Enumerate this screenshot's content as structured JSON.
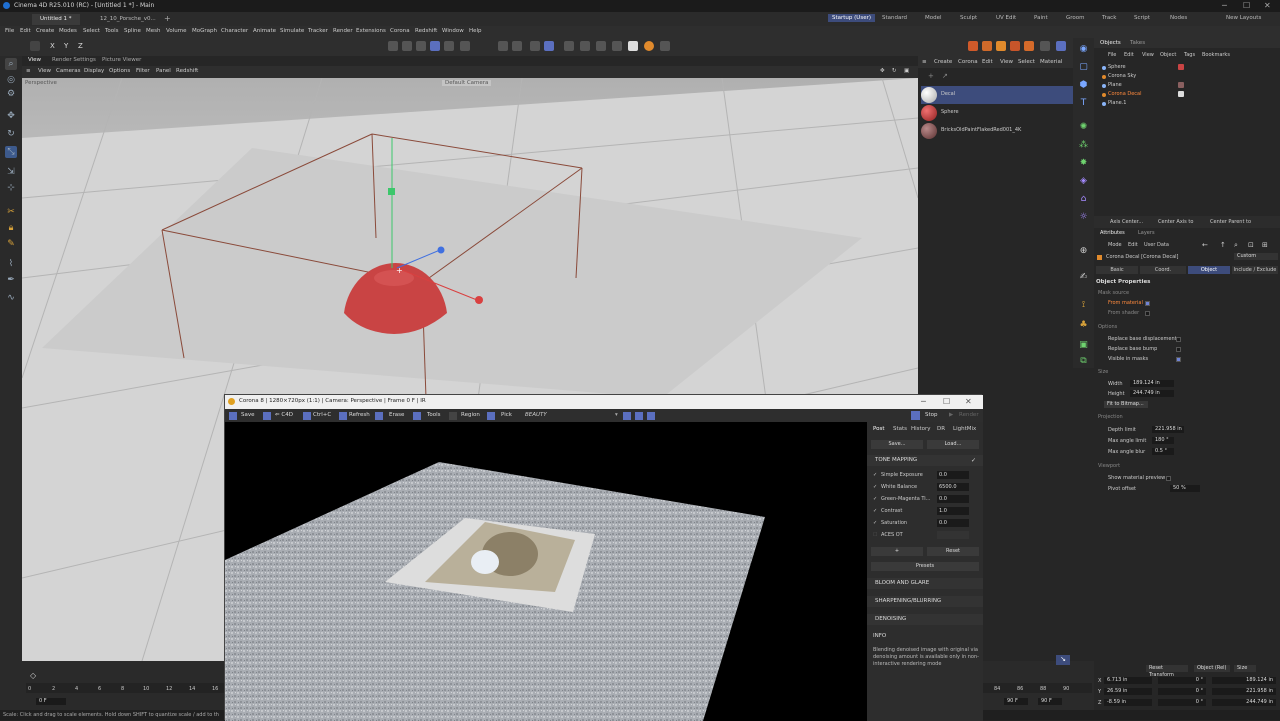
{
  "window_title": "Cinema 4D R25.010 (RC) - [Untitled 1 *] - Main",
  "doc_tabs": [
    "Untitled 1 *",
    "12_10_Porsche_v0..."
  ],
  "layouts": [
    "Startup (User)",
    "Standard",
    "Model",
    "Sculpt",
    "UV Edit",
    "Paint",
    "Groom",
    "Track",
    "Script",
    "Nodes"
  ],
  "new_layouts": "New Layouts",
  "menu": [
    "File",
    "Edit",
    "Create",
    "Modes",
    "Select",
    "Tools",
    "Spline",
    "Mesh",
    "Volume",
    "MoGraph",
    "Character",
    "Animate",
    "Simulate",
    "Tracker",
    "Render",
    "Extensions",
    "Corona",
    "Redshift",
    "Window",
    "Help"
  ],
  "toolbar_axes": [
    "X",
    "Y",
    "Z"
  ],
  "viewport": {
    "tabs": [
      "View",
      "Render Settings",
      "Picture Viewer"
    ],
    "menu": [
      "View",
      "Cameras",
      "Display",
      "Options",
      "Filter",
      "Panel",
      "Redshift"
    ],
    "projection": "Perspective",
    "camera": "Default Camera"
  },
  "materials": {
    "menu": [
      "Create",
      "Corona",
      "Edit",
      "View",
      "Select",
      "Material"
    ],
    "items": [
      {
        "name": "Decal",
        "color": "#e8e8e8"
      },
      {
        "name": "Sphere",
        "color": "#c03a3a"
      },
      {
        "name": "BricksOldPaintFlakedRed001_4K",
        "color": "#8a5a5a"
      }
    ]
  },
  "objects": {
    "tabs": [
      "Objects",
      "Takes"
    ],
    "menu": [
      "File",
      "Edit",
      "View",
      "Object",
      "Tags",
      "Bookmarks"
    ],
    "items": [
      "Sphere",
      "Corona Sky",
      "Plane",
      "Corona Decal",
      "Plane.1"
    ]
  },
  "axis_bar": [
    "Axis Center...",
    "Center Axis to",
    "Center Parent to"
  ],
  "attributes": {
    "tabs": [
      "Attributes",
      "Layers"
    ],
    "menu": [
      "Mode",
      "Edit",
      "User Data"
    ],
    "object_name": "Corona Decal [Corona Decal]",
    "preset": "Custom",
    "subtabs": [
      "Basic",
      "Coord.",
      "Object",
      "Include / Exclude"
    ],
    "section": "Object Properties",
    "mask_source": "Mask source",
    "from_material": "From material",
    "from_shader": "From shader",
    "options": "Options",
    "replace_disp": "Replace base displacement",
    "replace_bump": "Replace base bump",
    "visible_masks": "Visible in masks",
    "size": "Size",
    "width_label": "Width",
    "width": "189.124 in",
    "height_label": "Height",
    "height": "244.749 in",
    "fit_btn": "Fit to Bitmap...",
    "projection": "Projection",
    "depth_label": "Depth limit",
    "depth": "221.958 in",
    "max_angle_label": "Max angle limit",
    "max_angle": "180 °",
    "max_blur_label": "Max angle blur",
    "max_blur": "0.5 °",
    "viewport": "Viewport",
    "show_preview": "Show material preview",
    "pivot_label": "Pivot offset",
    "pivot": "50 %"
  },
  "transform": {
    "reset": "Reset Transform",
    "mode": "Object (Rel)",
    "size": "Size",
    "rows": [
      {
        "axis": "X",
        "pos": "6.713 in",
        "rot": "0 °",
        "size": "189.124 in"
      },
      {
        "axis": "Y",
        "pos": "26.59 in",
        "rot": "0 °",
        "size": "221.958 in"
      },
      {
        "axis": "Z",
        "pos": "-8.59 in",
        "rot": "0 °",
        "size": "244.749 in"
      }
    ]
  },
  "timeline": {
    "ticks": [
      "0",
      "2",
      "4",
      "6",
      "8",
      "10",
      "12",
      "14",
      "16"
    ],
    "right_ticks": [
      "84",
      "86",
      "88",
      "90"
    ],
    "start": "0 F",
    "end1": "90 F",
    "end2": "90 F"
  },
  "status": "Scale: Click and drag to scale elements. Hold down SHIFT to quantize scale / add to th",
  "corona": {
    "title": "Corona 8 | 1280×720px (1:1) | Camera: Perspective | Frame 0 F | IR",
    "tools": [
      "Save",
      "⇐ C4D",
      "Ctrl+C",
      "Refresh",
      "Erase",
      "Tools",
      "Region",
      "Pick"
    ],
    "pass": "BEAUTY",
    "stop": "Stop",
    "render": "Render",
    "side_tabs": [
      "Post",
      "Stats",
      "History",
      "DR",
      "LightMix"
    ],
    "save": "Save...",
    "load": "Load...",
    "tone_mapping": "TONE MAPPING",
    "params": [
      {
        "label": "Simple Exposure",
        "value": "0.0",
        "on": true
      },
      {
        "label": "White Balance",
        "value": "6500.0",
        "on": true
      },
      {
        "label": "Green-Magenta Ti...",
        "value": "0.0",
        "on": true
      },
      {
        "label": "Contrast",
        "value": "1.0",
        "on": true
      },
      {
        "label": "Saturation",
        "value": "0.0",
        "on": true
      },
      {
        "label": "ACES OT",
        "value": "",
        "on": false
      }
    ],
    "plus": "+",
    "reset": "Reset",
    "presets": "Presets",
    "bloom": "BLOOM AND GLARE",
    "sharpen": "SHARPENING/BLURRING",
    "denoise": "DENOISING",
    "info": "INFO",
    "info_text": "Blending denoised image with original via denoising amount is available only in non-interactive rendering mode"
  }
}
